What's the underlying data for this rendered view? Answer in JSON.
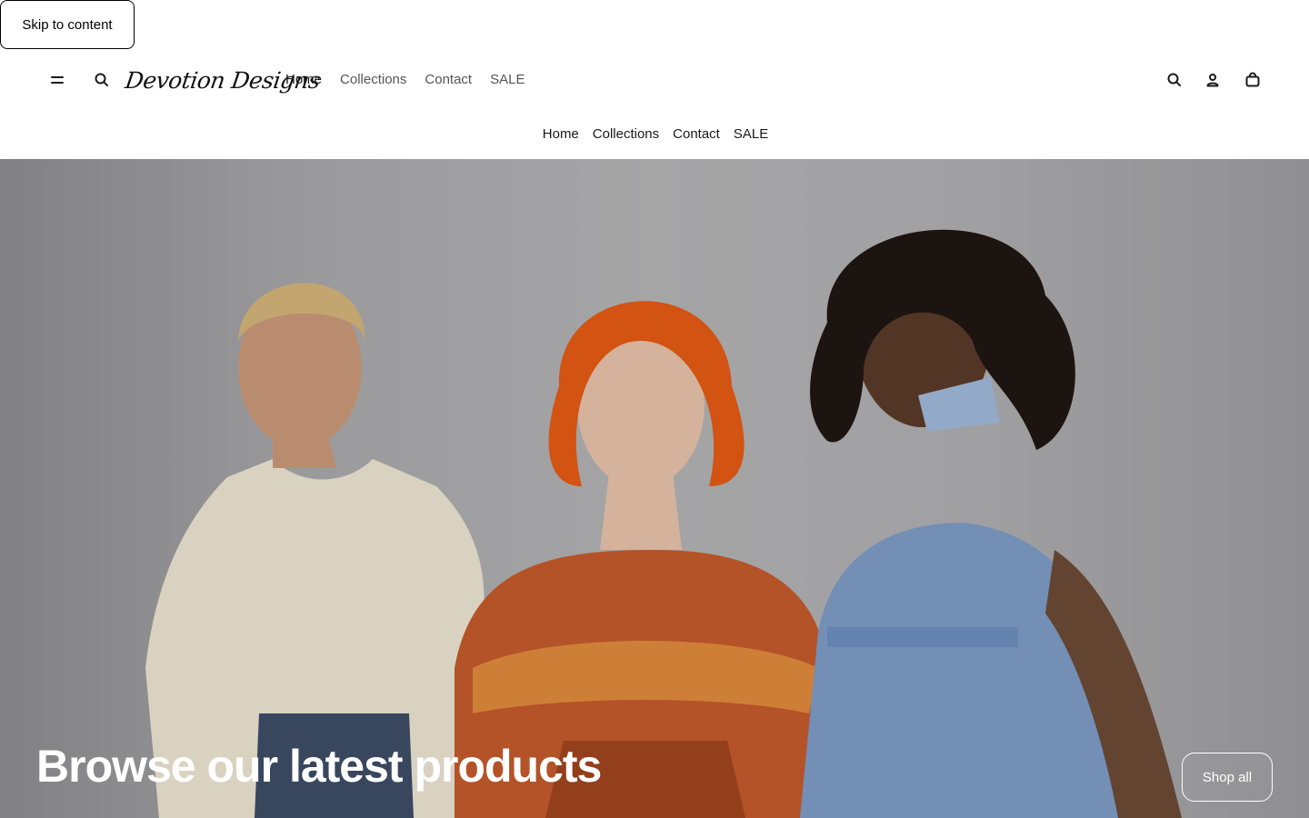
{
  "skip_link": {
    "label": "Skip to content"
  },
  "header": {
    "logo_text": "Devotion Designs",
    "primary_nav": [
      {
        "label": "Home",
        "active": true
      },
      {
        "label": "Collections",
        "active": false
      },
      {
        "label": "Contact",
        "active": false
      },
      {
        "label": "SALE",
        "active": false
      }
    ],
    "secondary_nav": [
      {
        "label": "Home"
      },
      {
        "label": "Collections"
      },
      {
        "label": "Contact"
      },
      {
        "label": "SALE"
      }
    ],
    "icons": {
      "menu": "hamburger-icon",
      "search_left": "search-icon",
      "search_right": "search-icon",
      "account": "user-icon",
      "cart": "shopping-bag-icon"
    }
  },
  "hero": {
    "heading": "Browse our latest products",
    "button_label": "Shop all"
  },
  "colors": {
    "text": "#1a1a1a",
    "nav_muted": "#555555",
    "hero_text": "#ffffff"
  }
}
